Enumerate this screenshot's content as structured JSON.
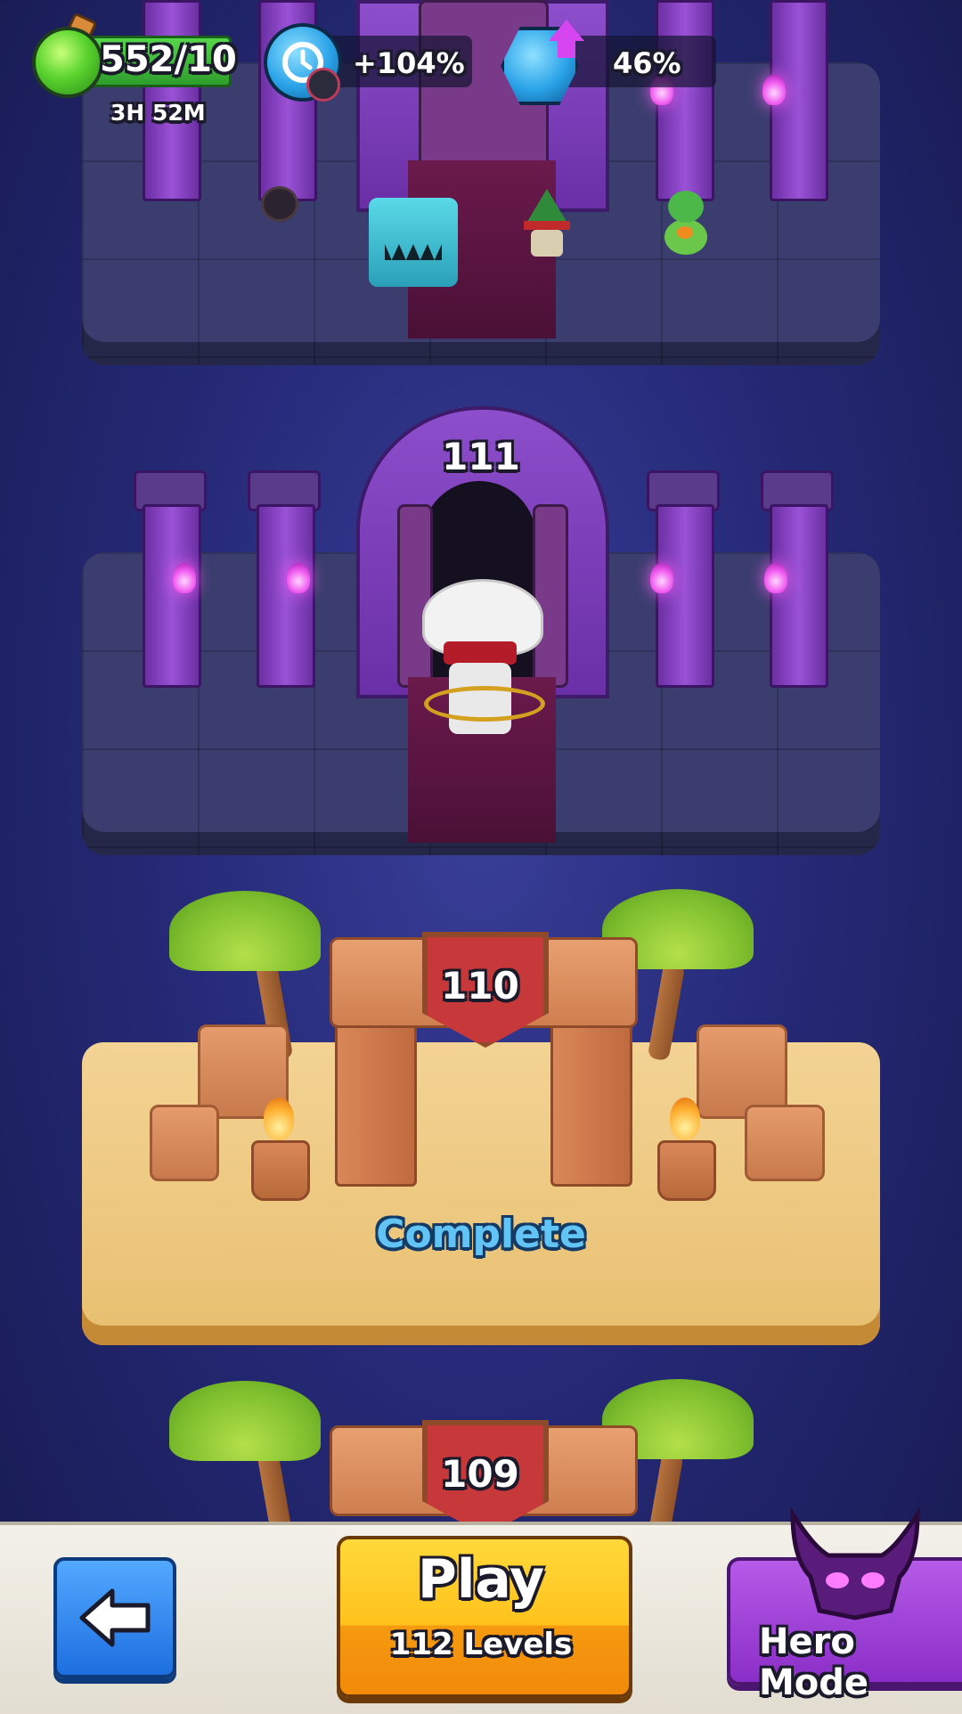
{
  "hud": {
    "energy_value": "552/10",
    "energy_timer": "3H 52M",
    "boost_value": "+104%",
    "gem_value": "46%"
  },
  "levels": [
    {
      "number": "111",
      "theme": "dungeon"
    },
    {
      "number": "110",
      "theme": "desert",
      "status": "Complete"
    },
    {
      "number": "109",
      "theme": "desert"
    }
  ],
  "bottom_bar": {
    "play_label": "Play",
    "play_sub": "112 Levels",
    "hero_mode_label": "Hero Mode"
  },
  "icons": {
    "energy": "potion-icon",
    "boost": "clock-icon",
    "gem": "gem-icon",
    "back": "arrow-left-icon",
    "hero_mode": "demon-icon"
  },
  "colors": {
    "background": "#262a78",
    "play_button": "#ffc21c",
    "back_button": "#1d6fe0",
    "hero_button": "#8a2ec8",
    "level_badge": "#c7383a",
    "complete_text": "#62c4f5"
  }
}
